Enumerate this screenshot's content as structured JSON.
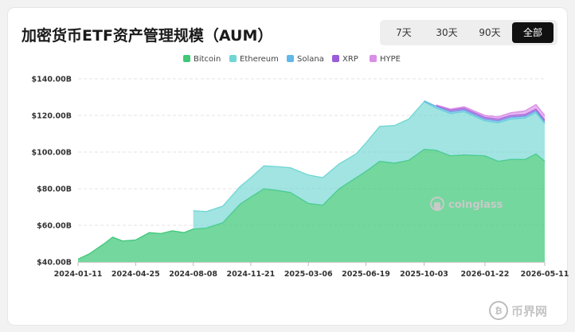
{
  "title": "加密货币ETF资产管理规模（AUM）",
  "range_buttons": [
    {
      "label": "7天",
      "active": false
    },
    {
      "label": "30天",
      "active": false
    },
    {
      "label": "90天",
      "active": false
    },
    {
      "label": "全部",
      "active": true
    }
  ],
  "watermark": "coinglass",
  "badge_text": "币界网",
  "chart_data": {
    "type": "area",
    "stacked": true,
    "legend": [
      "Bitcoin",
      "Ethereum",
      "Solana",
      "XRP",
      "HYPE"
    ],
    "colors": {
      "Bitcoin": "#3ec878",
      "Ethereum": "#6fd6d3",
      "Solana": "#62b8e8",
      "XRP": "#9b5cd9",
      "HYPE": "#d98ee8"
    },
    "ylim": [
      40,
      140
    ],
    "y_ticks": [
      "$40.00B",
      "$60.00B",
      "$80.00B",
      "$100.00B",
      "$120.00B",
      "$140.00B"
    ],
    "x_ticks": [
      "2024-01-11",
      "2024-04-25",
      "2024-08-08",
      "2024-11-21",
      "2025-03-06",
      "2025-06-19",
      "2025-10-03",
      "2026-01-22",
      "2026-05-11"
    ],
    "x": [
      "2024-01-11",
      "2024-02-01",
      "2024-03-01",
      "2024-03-14",
      "2024-04-01",
      "2024-04-25",
      "2024-05-20",
      "2024-06-10",
      "2024-07-01",
      "2024-07-22",
      "2024-08-08",
      "2024-09-01",
      "2024-10-01",
      "2024-11-01",
      "2024-11-21",
      "2024-12-15",
      "2025-01-10",
      "2025-02-01",
      "2025-03-06",
      "2025-04-01",
      "2025-05-01",
      "2025-06-01",
      "2025-06-19",
      "2025-07-14",
      "2025-08-10",
      "2025-09-05",
      "2025-10-03",
      "2025-10-25",
      "2025-11-20",
      "2025-12-15",
      "2026-01-22",
      "2026-02-15",
      "2026-03-10",
      "2026-04-05",
      "2026-04-25",
      "2026-05-11"
    ],
    "series": [
      {
        "name": "Bitcoin",
        "values": [
          41.5,
          44.5,
          50.5,
          53.5,
          51.5,
          52.0,
          56.0,
          55.5,
          57.0,
          56.0,
          58.0,
          58.5,
          61.5,
          71.5,
          75.5,
          80.0,
          79.0,
          78.0,
          72.0,
          71.0,
          80.0,
          86.0,
          89.5,
          95.0,
          94.0,
          95.5,
          101.5,
          101.0,
          98.0,
          98.5,
          98.0,
          95.0,
          96.0,
          96.0,
          99.0,
          95.0
        ]
      },
      {
        "name": "Ethereum",
        "values": [
          0,
          0,
          0,
          0,
          0,
          0,
          0,
          0,
          0,
          0,
          10.0,
          9.0,
          9.0,
          9.5,
          10.5,
          12.5,
          13.0,
          13.5,
          15.5,
          15.0,
          13.5,
          13.0,
          15.5,
          19.0,
          20.5,
          22.5,
          26.0,
          23.0,
          23.0,
          23.5,
          19.0,
          21.0,
          22.0,
          22.5,
          22.5,
          20.5
        ]
      },
      {
        "name": "Solana",
        "values": [
          0,
          0,
          0,
          0,
          0,
          0,
          0,
          0,
          0,
          0,
          0,
          0,
          0,
          0,
          0,
          0,
          0,
          0,
          0,
          0,
          0,
          0,
          0,
          0,
          0,
          0,
          0.5,
          1.0,
          1.0,
          1.0,
          1.0,
          1.0,
          1.0,
          1.0,
          1.0,
          1.0
        ]
      },
      {
        "name": "XRP",
        "values": [
          0,
          0,
          0,
          0,
          0,
          0,
          0,
          0,
          0,
          0,
          0,
          0,
          0,
          0,
          0,
          0,
          0,
          0,
          0,
          0,
          0,
          0,
          0,
          0,
          0,
          0,
          0,
          0.6,
          1.0,
          1.0,
          1.0,
          1.0,
          1.0,
          1.0,
          1.0,
          1.0
        ]
      },
      {
        "name": "HYPE",
        "values": [
          0,
          0,
          0,
          0,
          0,
          0,
          0,
          0,
          0,
          0,
          0,
          0,
          0,
          0,
          0,
          0,
          0,
          0,
          0,
          0,
          0,
          0,
          0,
          0,
          0,
          0,
          0,
          0.2,
          0.5,
          0.8,
          1.0,
          1.2,
          1.5,
          2.0,
          2.5,
          2.5
        ]
      }
    ],
    "grid": true,
    "legend_position": "top-center"
  }
}
